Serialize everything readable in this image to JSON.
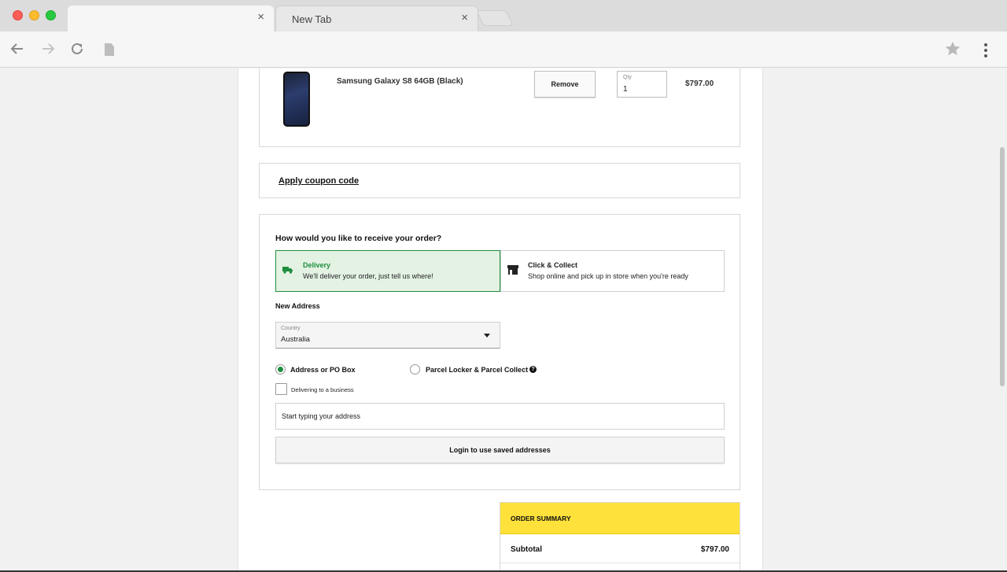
{
  "browser": {
    "tabs": [
      {
        "title": ""
      },
      {
        "title": "New Tab"
      }
    ],
    "tab_close_glyph": "×",
    "icons": [
      "back-arrow-icon",
      "forward-arrow-icon",
      "reload-icon",
      "page-icon",
      "star-icon",
      "menu-dots-icon"
    ]
  },
  "cart": {
    "product_name": "Samsung Galaxy S8 64GB (Black)",
    "remove_label": "Remove",
    "qty_label": "Qty",
    "qty_value": "1",
    "price": "$797.00"
  },
  "coupon": {
    "label": "Apply coupon code"
  },
  "fulfilment": {
    "question": "How would you like to receive your order?",
    "options": [
      {
        "title": "Delivery",
        "subtitle": "We'll deliver your order, just tell us where!",
        "icon": "truck-icon",
        "selected": true
      },
      {
        "title": "Click & Collect",
        "subtitle": "Shop online and pick up in store when you're ready",
        "icon": "store-icon",
        "selected": false
      }
    ],
    "new_address_heading": "New Address",
    "country_label": "Country",
    "country_value": "Australia",
    "address_types": [
      {
        "label": "Address or PO Box",
        "selected": true
      },
      {
        "label": "Parcel Locker & Parcel Collect",
        "selected": false
      }
    ],
    "help_glyph": "?",
    "business_checkbox_label": "Delivering to a business",
    "business_checked": false,
    "address_placeholder": "Start typing your address",
    "login_button": "Login to use saved addresses"
  },
  "summary": {
    "title": "ORDER SUMMARY",
    "subtotal_label": "Subtotal",
    "subtotal_value": "$797.00"
  },
  "colors": {
    "accent_green": "#1e8e3e",
    "summary_yellow": "#ffe13b",
    "selected_option_bg": "#e3f2e3"
  }
}
